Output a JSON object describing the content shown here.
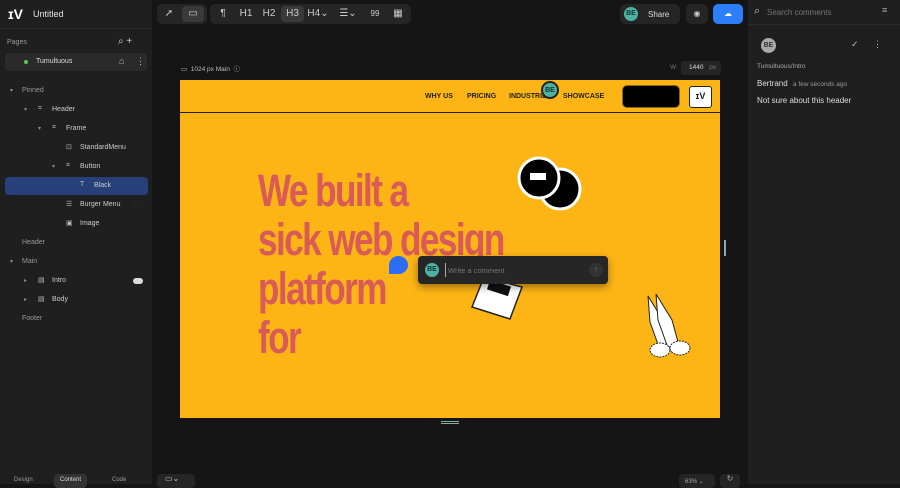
{
  "app": {
    "logo": "ɪV",
    "title": "Untitled"
  },
  "pages": {
    "label": "Pages",
    "items": [
      {
        "label": "Tumultuous"
      }
    ]
  },
  "layers": [
    {
      "label": "Pinned",
      "level": 0,
      "kind": "section"
    },
    {
      "label": "Header",
      "level": 1,
      "kind": "frame"
    },
    {
      "label": "Frame",
      "level": 2,
      "kind": "frame"
    },
    {
      "label": "StandardMenu",
      "level": 3,
      "kind": "component"
    },
    {
      "label": "Button",
      "level": 3,
      "kind": "frame"
    },
    {
      "label": "Black",
      "level": 4,
      "kind": "text",
      "selected": true
    },
    {
      "label": "Burger Menu",
      "level": 3,
      "kind": "menu"
    },
    {
      "label": "Image",
      "level": 3,
      "kind": "image"
    },
    {
      "label": "Header",
      "level": 0,
      "kind": "section"
    },
    {
      "label": "Main",
      "level": 0,
      "kind": "section"
    },
    {
      "label": "Intro",
      "level": 1,
      "kind": "page"
    },
    {
      "label": "Body",
      "level": 1,
      "kind": "page"
    },
    {
      "label": "Footer",
      "level": 0,
      "kind": "section"
    }
  ],
  "bottom_tabs": [
    "Design",
    "Content",
    "Code"
  ],
  "toolbar": {
    "para": "¶",
    "h1": "H1",
    "h2": "H2",
    "h3": "H3",
    "h4": "H4",
    "quote": "99"
  },
  "share": {
    "avatar": "BE",
    "label": "Share"
  },
  "canvas": {
    "breakpoint": "1024 px Main",
    "width_label": "W",
    "width_value": "1440",
    "width_unit": "px",
    "zoom": "63%"
  },
  "site": {
    "nav": [
      "WHY US",
      "PRICING",
      "INDUSTRIES",
      "SHOWCASE"
    ],
    "logo": "ɪV",
    "heading": [
      "We built a",
      "sick web design",
      "platform",
      "for"
    ],
    "cursor_avatar": "BE"
  },
  "comment_box": {
    "avatar": "BE",
    "placeholder": "Write a comment"
  },
  "comments": {
    "search_placeholder": "Search comments",
    "items": [
      {
        "avatar": "BE",
        "path": "Tumultuous/Intro",
        "author": "Bertrand",
        "time": "a few seconds ago",
        "text": "Not sure about this header"
      }
    ]
  },
  "colors": {
    "accent": "#2d7ff9",
    "page_bg": "#fdb515",
    "heading": "#d95a57"
  }
}
